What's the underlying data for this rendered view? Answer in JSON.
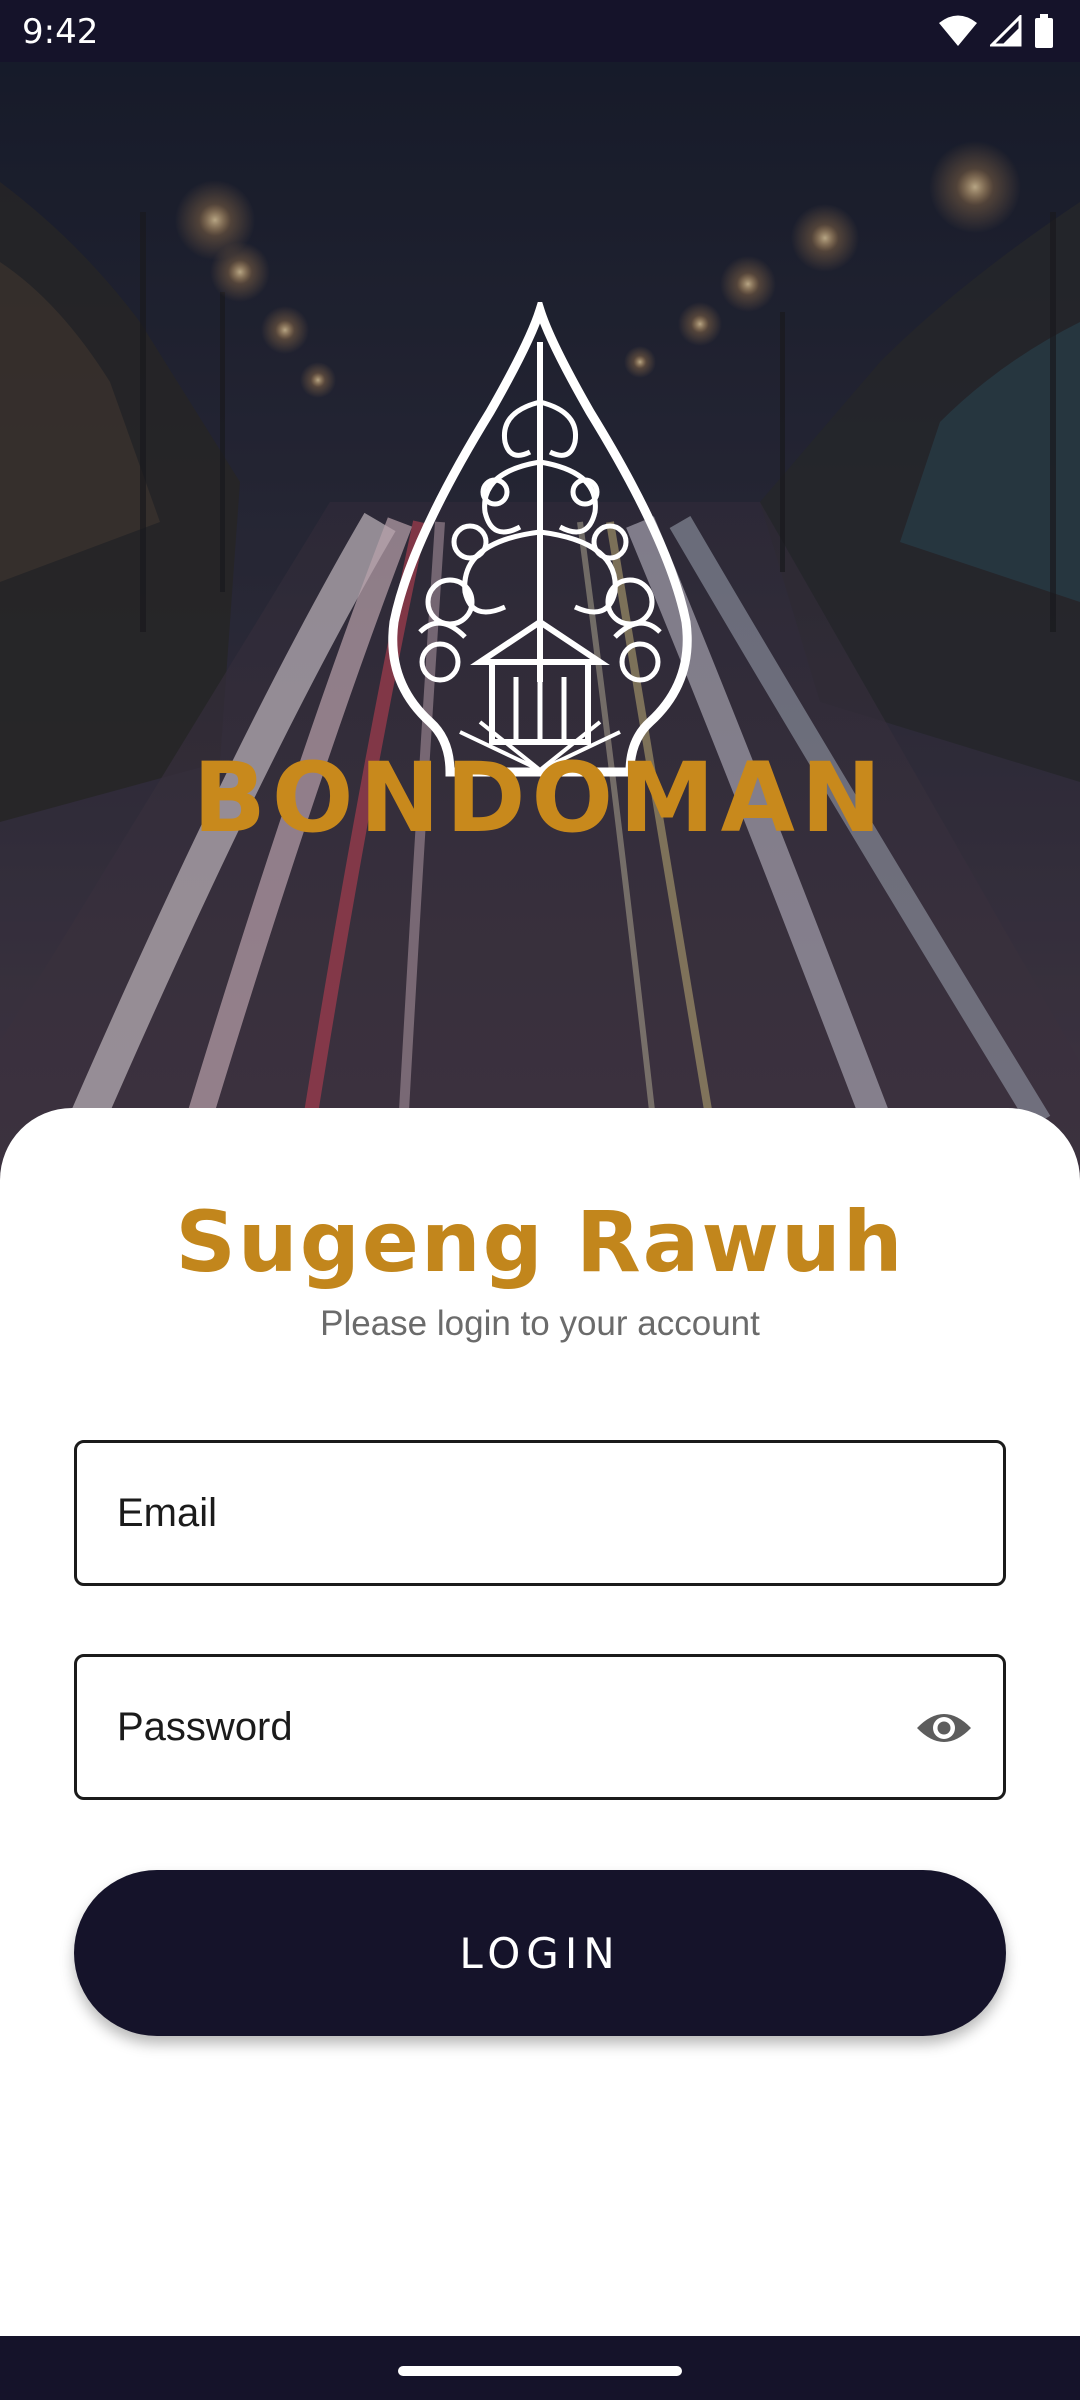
{
  "status_bar": {
    "time": "9:42",
    "icons": [
      "wifi-icon",
      "signal-icon",
      "battery-icon"
    ]
  },
  "hero": {
    "brand_name": "BONDOMAN",
    "logo": "gunungan-wayang-logo",
    "background": "night-highway-light-trails"
  },
  "login_card": {
    "title": "Sugeng Rawuh",
    "subtitle": "Please login to your account",
    "email": {
      "placeholder": "Email",
      "value": ""
    },
    "password": {
      "placeholder": "Password",
      "value": "",
      "toggle_icon": "eye-icon"
    },
    "login_button": "LOGIN"
  },
  "colors": {
    "brand_gold": "#c2861c",
    "dark_navy": "#15132a",
    "card_background": "#ffffff",
    "subtitle_gray": "#6b6b6b"
  }
}
